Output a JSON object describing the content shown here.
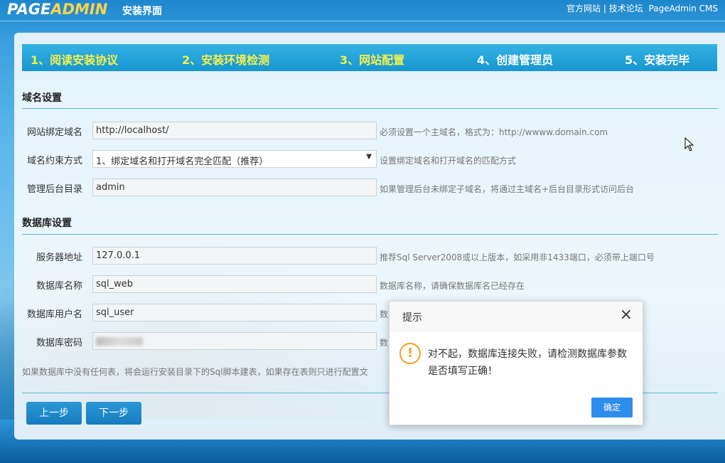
{
  "header": {
    "logo_part1": "PAGE",
    "logo_part2": "ADMIN",
    "subtitle": "安装界面",
    "link_official": "官方网站",
    "separator": "|",
    "link_forum": "技术论坛",
    "brand": "PageAdmin CMS"
  },
  "steps": [
    {
      "label": "1、阅读安装协议",
      "state": "done"
    },
    {
      "label": "2、安装环境检测",
      "state": "done"
    },
    {
      "label": "3、网站配置",
      "state": "done"
    },
    {
      "label": "4、创建管理员",
      "state": "todo"
    },
    {
      "label": "5、安装完毕",
      "state": "todo"
    }
  ],
  "domain_section": {
    "title": "域名设置",
    "rows": [
      {
        "label": "网站绑定域名",
        "value": "http://localhost/",
        "hint": "必须设置一个主域名，格式为：http://wwww.domain.com"
      },
      {
        "label": "域名约束方式",
        "value": "1、绑定域名和打开域名完全匹配（推荐）",
        "hint": "设置绑定域名和打开域名的匹配方式"
      },
      {
        "label": "管理后台目录",
        "value": "admin",
        "hint": "如果管理后台未绑定子域名，将通过主域名+后台目录形式访问后台"
      }
    ]
  },
  "db_section": {
    "title": "数据库设置",
    "rows": [
      {
        "label": "服务器地址",
        "value": "127.0.0.1",
        "hint": "推荐Sql Server2008或以上版本，如采用非1433端口，必须带上端口号"
      },
      {
        "label": "数据库名称",
        "value": "sql_web",
        "hint": "数据库名称，请确保数据库名已经存在"
      },
      {
        "label": "数据库用户名",
        "value": "sql_user",
        "hint": "数"
      },
      {
        "label": "数据库密码",
        "value": "",
        "hint": "数"
      }
    ],
    "note": "如果数据库中没有任何表，将会运行安装目录下的Sql脚本建表，如果存在表则只进行配置文"
  },
  "buttons": {
    "prev": "上一步",
    "next": "下一步"
  },
  "dialog": {
    "title": "提示",
    "close": "×",
    "icon": "!",
    "message": "对不起，数据库连接失败，请检测数据库参数是否填写正确！",
    "ok": "确定"
  },
  "colors": {
    "step_done": "#f7f04a",
    "step_todo": "#ffffff",
    "step_bar": "#1fa2dc",
    "button": "#1a86c6",
    "dialog_button": "#2e8ded",
    "warning_icon": "#f0a020"
  }
}
